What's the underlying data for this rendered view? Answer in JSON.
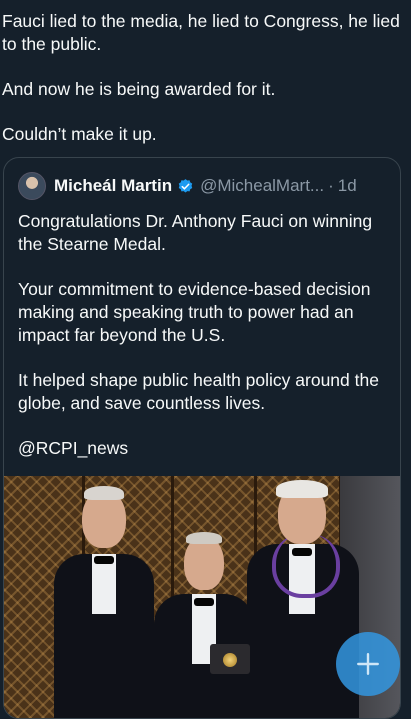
{
  "tweet": {
    "lines": [
      "Fauci lied to the media, he lied to Congress, he lied to the public.",
      "And now he is being awarded for it.",
      "Couldn’t make it up."
    ]
  },
  "quote": {
    "author_name": "Micheál Martin",
    "handle": "@MichealMart...",
    "separator": "·",
    "time": "1d",
    "verified_color": "#1d9bf0",
    "paragraphs": [
      "Congratulations Dr. Anthony Fauci on winning the Stearne Medal.",
      "Your commitment to evidence-based decision making and speaking truth to power had an impact far beyond the U.S.",
      "It helped shape public health policy around the globe, and save countless lives.",
      "@RCPI_news"
    ],
    "media": {
      "icon": "photo"
    }
  },
  "compose_button": {
    "icon": "plus-icon",
    "color": "#1d9bf0"
  }
}
